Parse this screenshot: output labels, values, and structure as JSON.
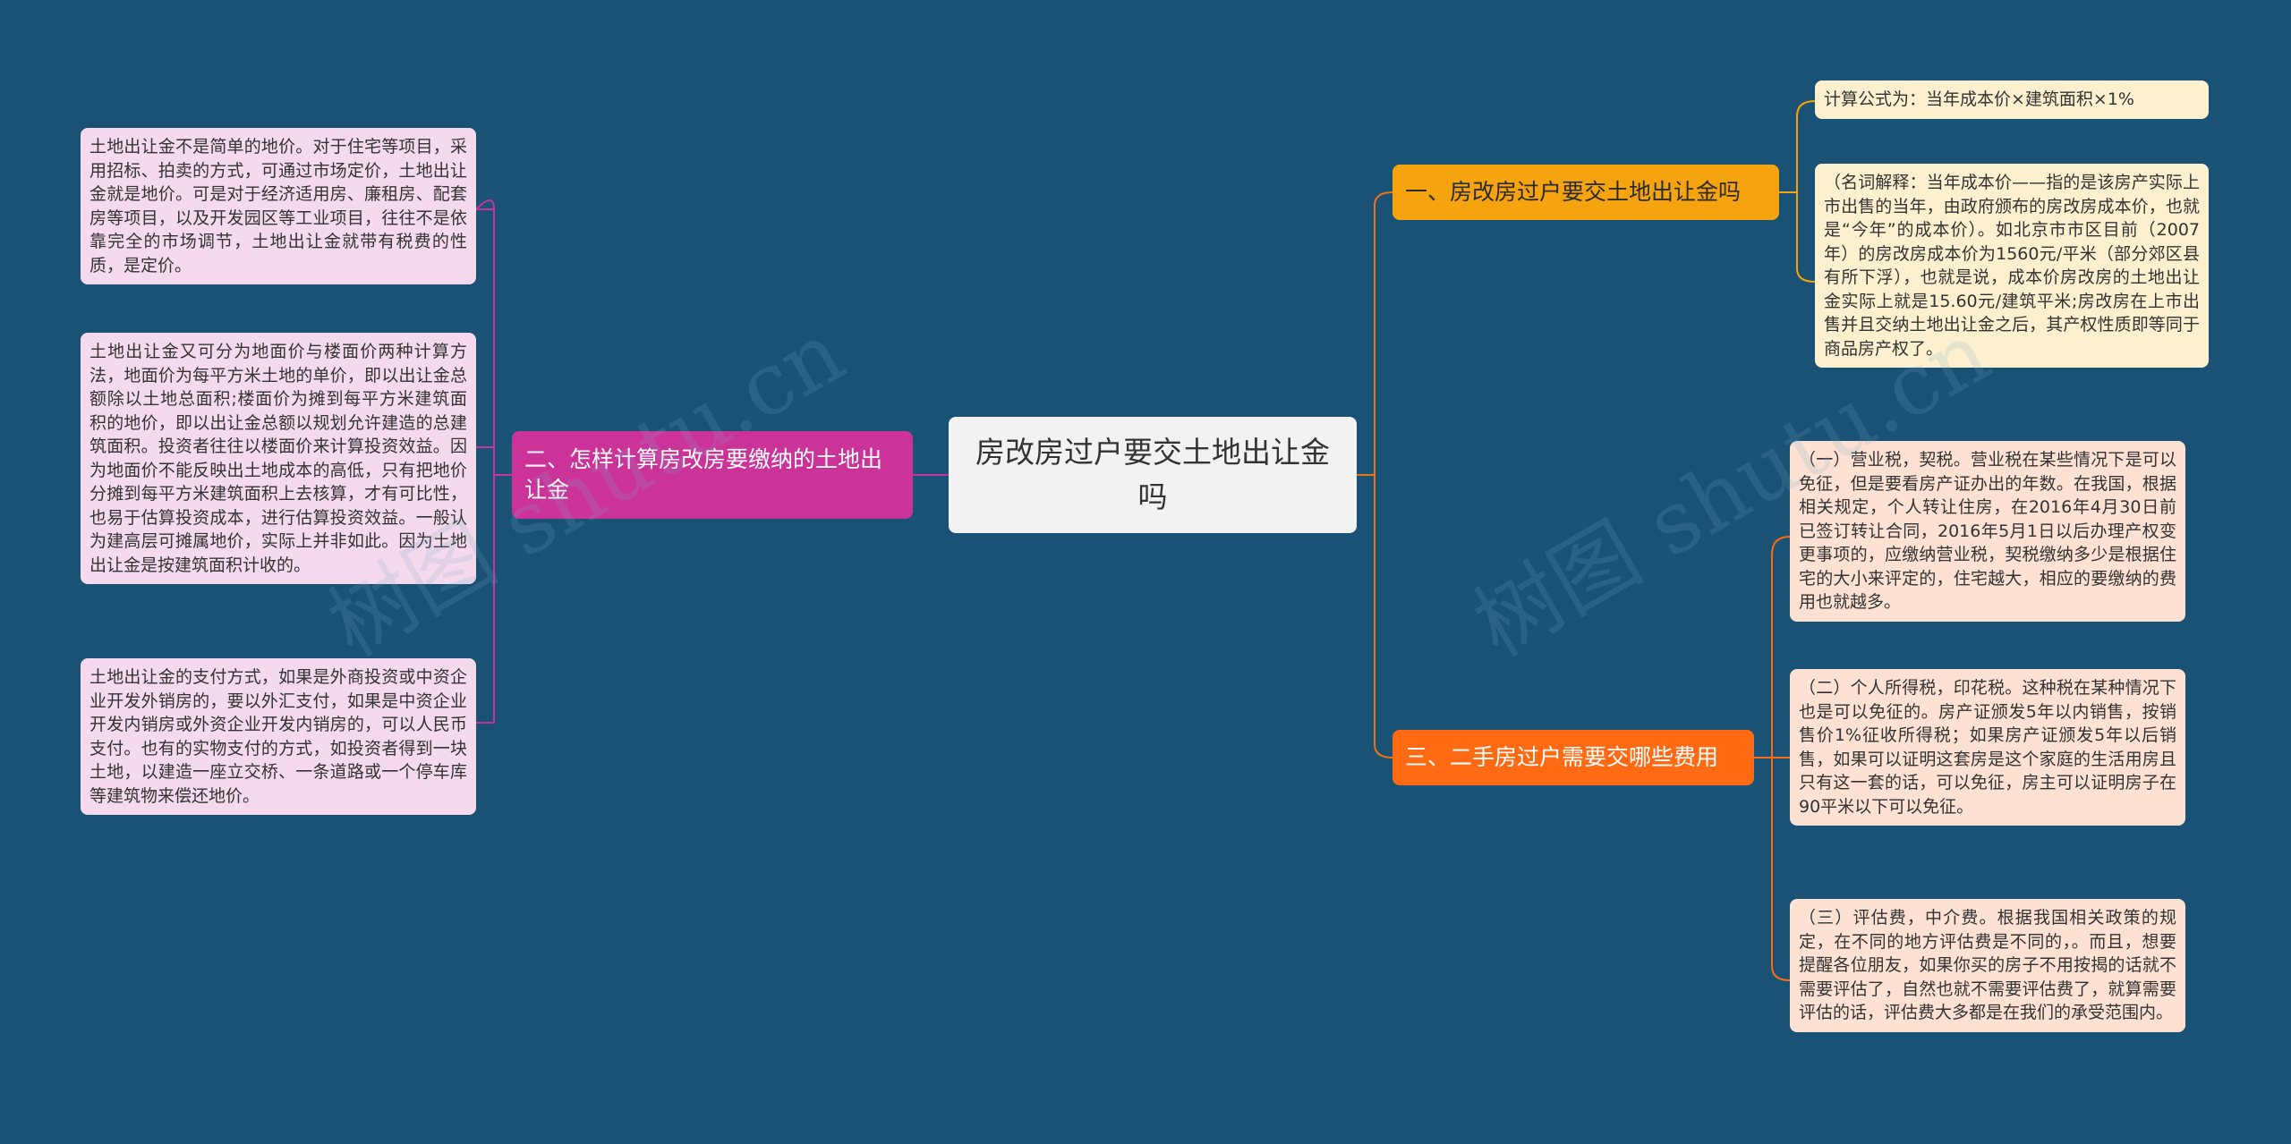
{
  "root": {
    "title": "房改房过户要交土地出让金吗"
  },
  "left_branch": {
    "label": "二、怎样计算房改房要缴纳的土地出让金",
    "leaves": [
      "土地出让金不是简单的地价。对于住宅等项目，采用招标、拍卖的方式，可通过市场定价，土地出让金就是地价。可是对于经济适用房、廉租房、配套房等项目，以及开发园区等工业项目，往往不是依靠完全的市场调节，土地出让金就带有税费的性质，是定价。",
      "土地出让金又可分为地面价与楼面价两种计算方法，地面价为每平方米土地的单价，即以出让金总额除以土地总面积;楼面价为摊到每平方米建筑面积的地价，即以出让金总额以规划允许建造的总建筑面积。投资者往往以楼面价来计算投资效益。因为地面价不能反映出土地成本的高低，只有把地价分摊到每平方米建筑面积上去核算，才有可比性，也易于估算投资成本，进行估算投资效益。一般认为建高层可摊属地价，实际上并非如此。因为土地出让金是按建筑面积计收的。",
      "土地出让金的支付方式，如果是外商投资或中资企业开发外销房的，要以外汇支付，如果是中资企业开发内销房或外资企业开发内销房的，可以人民币支付。也有的实物支付的方式，如投资者得到一块土地，以建造一座立交桥、一条道路或一个停车库等建筑物来偿还地价。"
    ]
  },
  "right_branch_1": {
    "label": "一、房改房过户要交土地出让金吗",
    "leaves": [
      "计算公式为：当年成本价×建筑面积×1%",
      "（名词解释：当年成本价——指的是该房产实际上市出售的当年，由政府颁布的房改房成本价，也就是“今年”的成本价）。如北京市市区目前（2007年）的房改房成本价为1560元/平米（部分郊区县有所下浮），也就是说，成本价房改房的土地出让金实际上就是15.60元/建筑平米;房改房在上市出售并且交纳土地出让金之后，其产权性质即等同于商品房产权了。"
    ]
  },
  "right_branch_3": {
    "label": "三、二手房过户需要交哪些费用",
    "leaves": [
      "（一）营业税，契税。营业税在某些情况下是可以免征，但是要看房产证办出的年数。在我国，根据相关规定，个人转让住房，在2016年4月30日前已签订转让合同，2016年5月1日以后办理产权变更事项的，应缴纳营业税，契税缴纳多少是根据住宅的大小来评定的，住宅越大，相应的要缴纳的费用也就越多。",
      "（二）个人所得税，印花税。这种税在某种情况下也是可以免征的。房产证颁发5年以内销售，按销售价1%征收所得税；如果房产证颁发5年以后销售，如果可以证明这套房是这个家庭的生活用房且只有这一套的话，可以免征，房主可以证明房子在90平米以下可以免征。",
      "（三）评估费，中介费。根据我国相关政策的规定，在不同的地方评估费是不同的，。而且，想要提醒各位朋友，如果你买的房子不用按揭的话就不需要评估了，自然也就不需要评估费了，就算需要评估的话，评估费大多都是在我们的承受范围内。"
    ]
  },
  "watermark": {
    "text_left": "树图 shutu.cn",
    "text_right": "树图 shutu.cn"
  },
  "colors": {
    "background": "#1a5276",
    "left_branch": "#cc3399",
    "right_branch_1": "#f5a30f",
    "right_branch_3": "#ff6a13",
    "connector_root_right": "#e8731a"
  }
}
